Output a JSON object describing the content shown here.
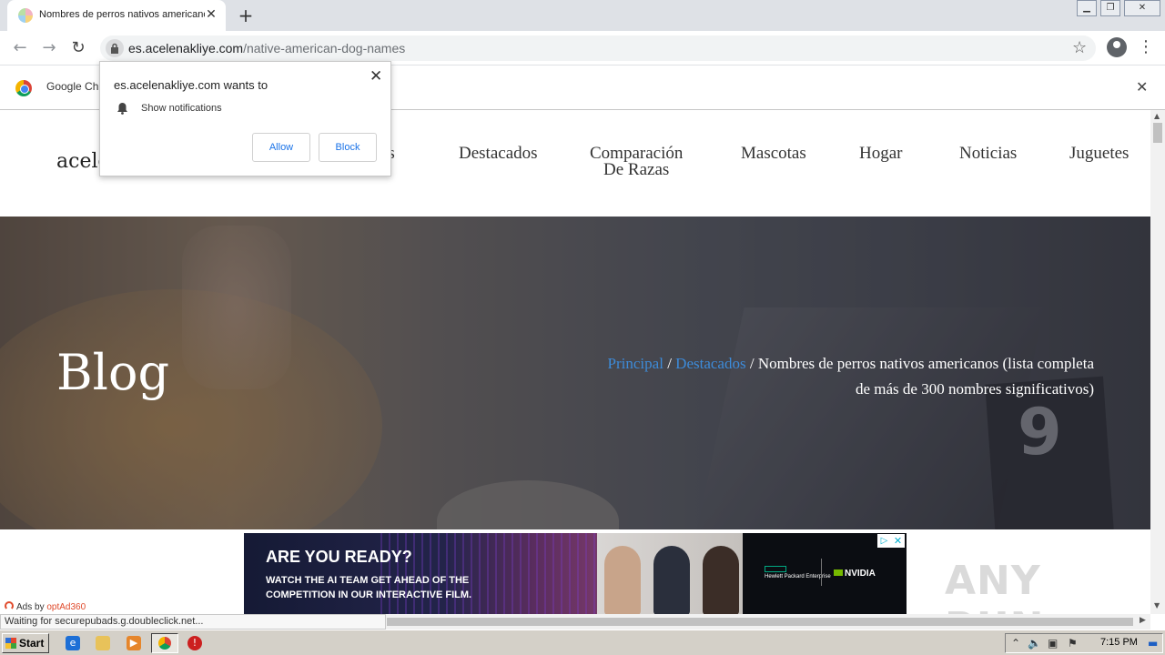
{
  "browser": {
    "tab_title": "Nombres de perros nativos americanos",
    "url_host": "es.acelenakliye.com",
    "url_path": "/native-american-dog-names",
    "infobar_text": "Google Ch"
  },
  "popup": {
    "title": "es.acelenakliye.com wants to",
    "permission": "Show notifications",
    "allow_label": "Allow",
    "block_label": "Block"
  },
  "site": {
    "logo_partial": "acele",
    "nav": [
      {
        "label": "as"
      },
      {
        "label": "Destacados"
      },
      {
        "label": "Comparación De Razas",
        "line1": "Comparación",
        "line2": "De Razas"
      },
      {
        "label": "Mascotas"
      },
      {
        "label": "Hogar"
      },
      {
        "label": "Noticias"
      },
      {
        "label": "Juguetes"
      }
    ]
  },
  "hero": {
    "title": "Blog",
    "sign_number": "9",
    "breadcrumb": {
      "home": "Principal",
      "sep": "/",
      "section": "Destacados",
      "current": "Nombres de perros nativos americanos (lista completa de más de 300 nombres significativos)"
    }
  },
  "ad": {
    "headline": "ARE YOU READY?",
    "subline": "WATCH THE AI TEAM GET AHEAD OF THE COMPETITION IN OUR INTERACTIVE FILM.",
    "sponsor1": "Hewlett Packard Enterprise",
    "sponsor2": "NVIDIA",
    "ads_by": "Ads by",
    "ads_brand": "optAd360"
  },
  "watermark": "ANY RUN",
  "status_text": "Waiting for securepubads.g.doubleclick.net...",
  "taskbar": {
    "start_label": "Start",
    "clock": "7:15 PM"
  },
  "colors": {
    "link": "#3d8bd9",
    "accent_blue": "#1a73e8"
  }
}
